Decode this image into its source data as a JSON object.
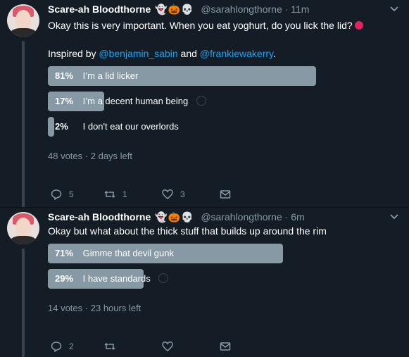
{
  "tweets": [
    {
      "author": {
        "name": "Scare-ah Bloodthorne",
        "emojis": "👻🎃💀",
        "handle": "@sarahlongthorne",
        "time": "11m"
      },
      "text_line1": "Okay this is very important. When you eat yoghurt, do you lick the lid?",
      "text_inspired_prefix": "Inspired by ",
      "mention1": "@benjamin_sabin",
      "text_and": " and ",
      "mention2": "@frankiewakerry",
      "text_period": ".",
      "poll": {
        "options": [
          {
            "pct": "81%",
            "label": "I’m a lid licker",
            "fraction": 0.81
          },
          {
            "pct": "17%",
            "label": "I’m a decent human being",
            "fraction": 0.17
          },
          {
            "pct": "2%",
            "label": "I don't eat our overlords",
            "fraction": 0.02
          }
        ],
        "votes": "48 votes",
        "time_left": "2 days left"
      },
      "actions": {
        "reply": "5",
        "retweet": "1",
        "like": "3"
      }
    },
    {
      "author": {
        "name": "Scare-ah Bloodthorne",
        "emojis": "👻🎃💀",
        "handle": "@sarahlongthorne",
        "time": "6m"
      },
      "text_line1": "Okay but what about the thick stuff that builds up around the rim",
      "poll": {
        "options": [
          {
            "pct": "71%",
            "label": "Gimme that devil gunk",
            "fraction": 0.71
          },
          {
            "pct": "29%",
            "label": "I have standards",
            "fraction": 0.29
          }
        ],
        "votes": "14 votes",
        "time_left": "23 hours left"
      },
      "actions": {
        "reply": "2",
        "retweet": "",
        "like": ""
      }
    }
  ],
  "separator": "·",
  "colors": {
    "background": "#141d26",
    "bar": "#8899a6",
    "muted": "#8899a6",
    "link": "#1da1f2"
  }
}
